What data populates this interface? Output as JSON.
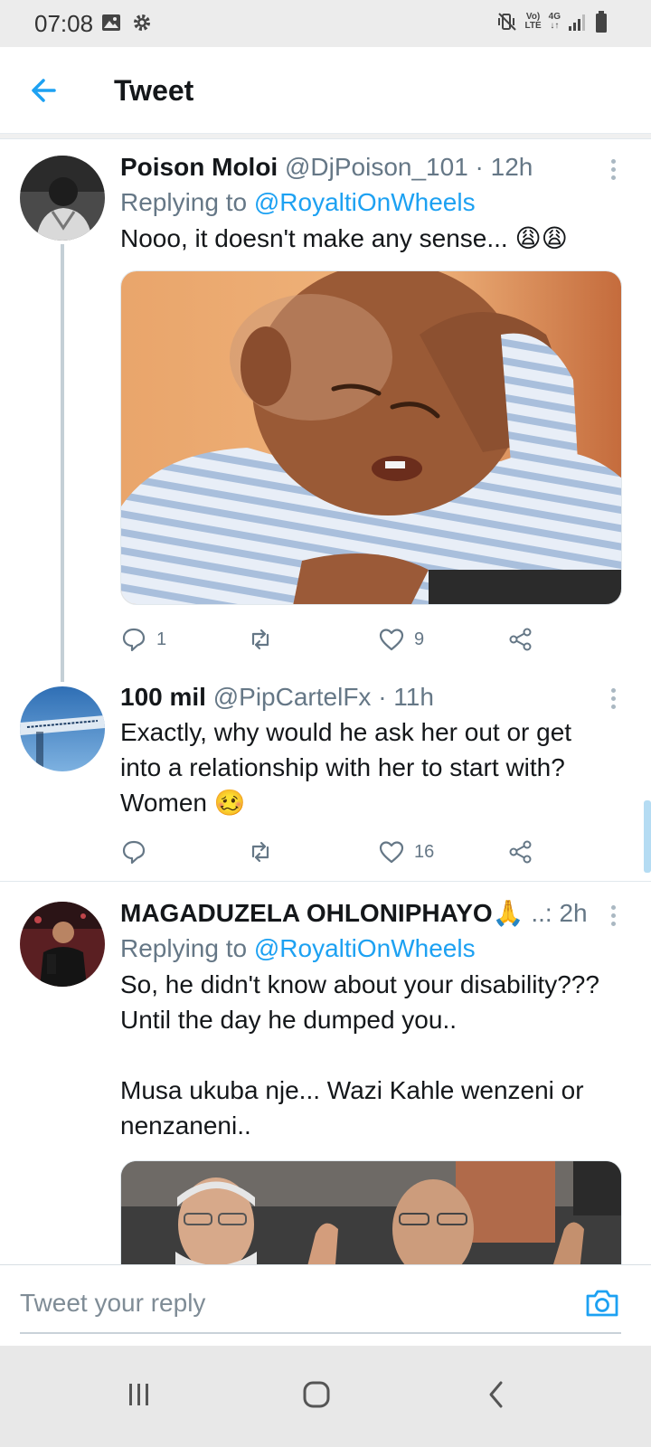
{
  "status_bar": {
    "time": "07:08",
    "network_top": "Vo)",
    "network_bottom": "LTE",
    "data_top": "4G",
    "data_bottom": "↓↑",
    "icons": [
      "image-icon",
      "gear-icon",
      "mute-vibrate-icon",
      "signal-icon",
      "battery-icon"
    ]
  },
  "header": {
    "title": "Tweet",
    "back_icon": "arrow-left-icon"
  },
  "tweets": [
    {
      "name": "Poison Moloi",
      "meta": "@DjPoison_101 · 12h",
      "replying_prefix": "Replying to",
      "replying_to": "@RoyaltiOnWheels",
      "text": "Nooo, it doesn't make any sense... 😩😩",
      "media": "photo of a crying toddler in a striped shirt",
      "replies": "1",
      "retweets": "",
      "likes": "9"
    },
    {
      "name": "100 mil",
      "meta": "@PipCartelFx · 11h",
      "text_lines": [
        "Exactly, why would he ask her out or get",
        "into a relationship with her to start with?",
        "Women 🥴"
      ],
      "replies": "",
      "retweets": "",
      "likes": "16"
    },
    {
      "name": "MAGADUZELA OHLONIPHAYO🙏",
      "meta": "..: 2h",
      "replying_prefix": "Replying to",
      "replying_to": "@RoyaltiOnWheels",
      "text_lines": [
        "So, he didn't know about your disability???",
        "Until the day he dumped you..",
        "",
        "Musa ukuba nje... Wazi Kahle wenzeni or",
        "nenzaneni.."
      ],
      "media": "photo of men clapping"
    }
  ],
  "reply_bar": {
    "placeholder": "Tweet your reply",
    "camera_icon": "camera-icon"
  },
  "nav_bar": {
    "buttons": [
      "recent-apps-icon",
      "home-icon",
      "back-icon"
    ]
  },
  "colors": {
    "accent": "#1da1f2",
    "meta": "#657786",
    "text": "#14171a",
    "divider": "#e1e8ed"
  }
}
